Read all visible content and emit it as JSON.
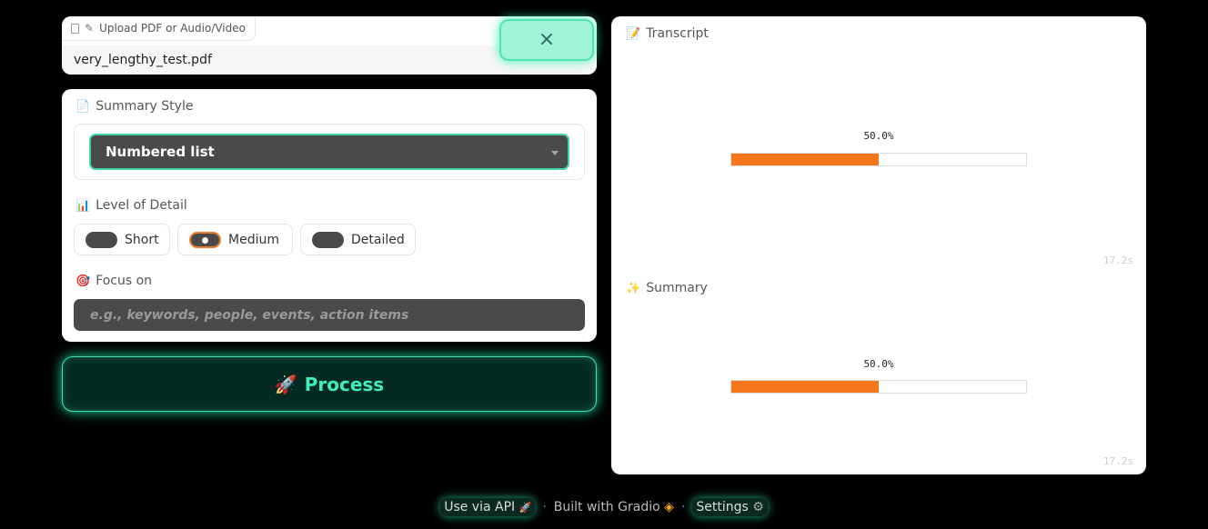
{
  "upload": {
    "tab_label": "Upload PDF or Audio/Video",
    "file_name": "very_lengthy_test.pdf",
    "clear_symbol": "×"
  },
  "settings": {
    "summary_style_label": "Summary Style",
    "summary_style_value": "Numbered list",
    "detail_label": "Level of Detail",
    "detail_options": [
      "Short",
      "Medium",
      "Detailed"
    ],
    "detail_selected": "Medium",
    "focus_label": "Focus on",
    "focus_placeholder": "e.g., keywords, people, events, action items"
  },
  "process": {
    "label": "Process"
  },
  "output": {
    "transcript": {
      "label": "Transcript",
      "progress_text": "50.0%",
      "progress": 0.5,
      "timer": "17.2s"
    },
    "summary": {
      "label": "Summary",
      "progress_text": "50.0%",
      "progress": 0.5,
      "timer": "17.2s"
    }
  },
  "footer": {
    "api": "Use via API",
    "built": "Built with Gradio",
    "settings": "Settings"
  },
  "colors": {
    "accent": "#3ef0b7",
    "progress": "#f5761a",
    "dark_input": "#4a4a4a"
  },
  "icons": {
    "summary_style": "document-icon",
    "detail": "bar-chart-icon",
    "focus": "target-icon",
    "process": "rocket-icon",
    "transcript": "memo-icon",
    "summary": "sparkles-icon"
  }
}
